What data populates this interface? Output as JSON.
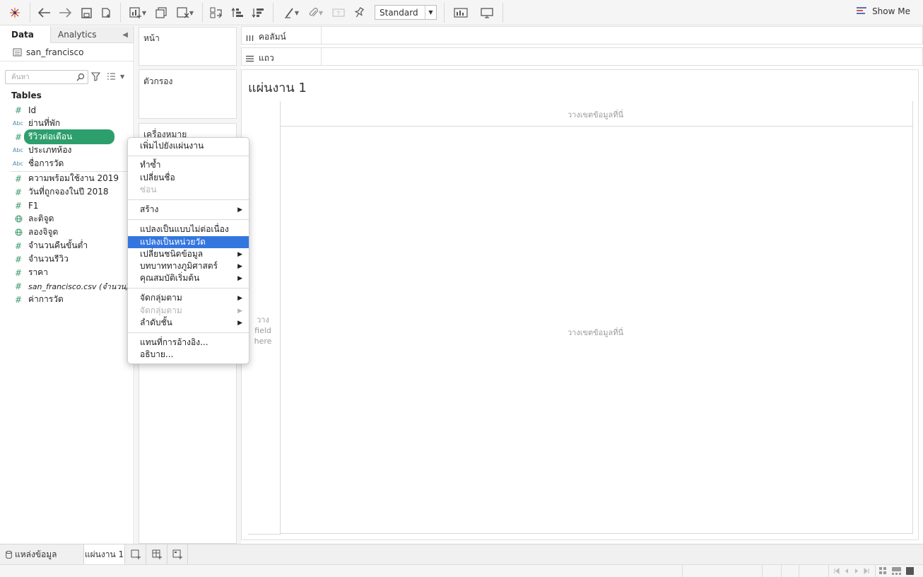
{
  "toolbar": {
    "fit_select": "Standard",
    "show_me_label": "Show Me",
    "icons": [
      "tableau-logo-icon",
      "undo-icon",
      "redo-icon",
      "save-icon",
      "new-datasource-icon",
      "new-worksheet-icon",
      "duplicate-sheet-icon",
      "clear-sheet-icon",
      "swap-axes-icon",
      "sort-ascending-icon",
      "sort-descending-icon",
      "highlight-icon",
      "group-icon",
      "labels-icon",
      "pin-icon",
      "show-cards-icon",
      "presentation-icon"
    ]
  },
  "data_pane": {
    "tabs": [
      "Data",
      "Analytics"
    ],
    "datasource": "san_francisco",
    "search_placeholder": "ค้นหา",
    "tables_heading": "Tables",
    "fields": [
      {
        "type": "#",
        "name": "Id"
      },
      {
        "type": "Abc",
        "name": "ย่านที่พัก"
      },
      {
        "type": "#",
        "name": "รีวิวต่อเดือน"
      },
      {
        "type": "Abc",
        "name": "ประเภทห้อง"
      },
      {
        "type": "Abc",
        "name": "ชื่อการวัด"
      },
      {
        "type": "#",
        "name": "ความพร้อมใช้งาน 2019"
      },
      {
        "type": "#",
        "name": "วันที่ถูกจองในปี 2018"
      },
      {
        "type": "#",
        "name": "F1"
      },
      {
        "type": "globe",
        "name": "ละติจูด"
      },
      {
        "type": "globe",
        "name": "ลองจิจูด"
      },
      {
        "type": "#",
        "name": "จำนวนคืนขั้นต่ำ"
      },
      {
        "type": "#",
        "name": "จำนวนรีวิว"
      },
      {
        "type": "#",
        "name": "ราคา"
      },
      {
        "type": "#",
        "name": "san_francisco.csv (จำนวน)"
      },
      {
        "type": "#",
        "name": "ค่าการวัด"
      }
    ]
  },
  "cards": {
    "pages": "หน้า",
    "filters": "ตัวกรอง",
    "marks": "เครื่องหมาย"
  },
  "shelves": {
    "columns": "คอลัมน์",
    "rows": "แถว"
  },
  "sheet": {
    "title": "แผ่นงาน 1",
    "drop_top": "วางเขตข้อมูลที่นี่",
    "drop_center": "วางเขตข้อมูลที่นี่",
    "drop_left": [
      "วาง",
      "field",
      "here"
    ]
  },
  "context_menu": {
    "items": [
      {
        "label": "เพิ่มไปยังแผ่นงาน"
      },
      {
        "label": "ทำซ้ำ"
      },
      {
        "label": "เปลี่ยนชื่อ"
      },
      {
        "label": "ซ่อน"
      },
      {
        "label": "สร้าง"
      },
      {
        "label": "แปลงเป็นแบบไม่ต่อเนื่อง"
      },
      {
        "label": "แปลงเป็นหน่วยวัด"
      },
      {
        "label": "เปลี่ยนชนิดข้อมูล"
      },
      {
        "label": "บทบาททางภูมิศาสตร์"
      },
      {
        "label": "คุณสมบัติเริ่มต้น"
      },
      {
        "label": "จัดกลุ่มตาม"
      },
      {
        "label": "จัดกลุ่มตาม"
      },
      {
        "label": "ลำดับชั้น"
      },
      {
        "label": "แทนที่การอ้างอิง..."
      },
      {
        "label": "อธิบาย..."
      }
    ],
    "highlighted": "แปลงเป็นหน่วยวัด"
  },
  "bottom_tabs": {
    "datasource_tab": "แหล่งข้อมูล",
    "sheet_tab": "แผ่นงาน 1"
  },
  "colors": {
    "selected_field": "#2d9f6d",
    "menu_highlight": "#3476df",
    "field_type_blue": "#4a8ab0",
    "field_type_green": "#3c9a6e"
  }
}
